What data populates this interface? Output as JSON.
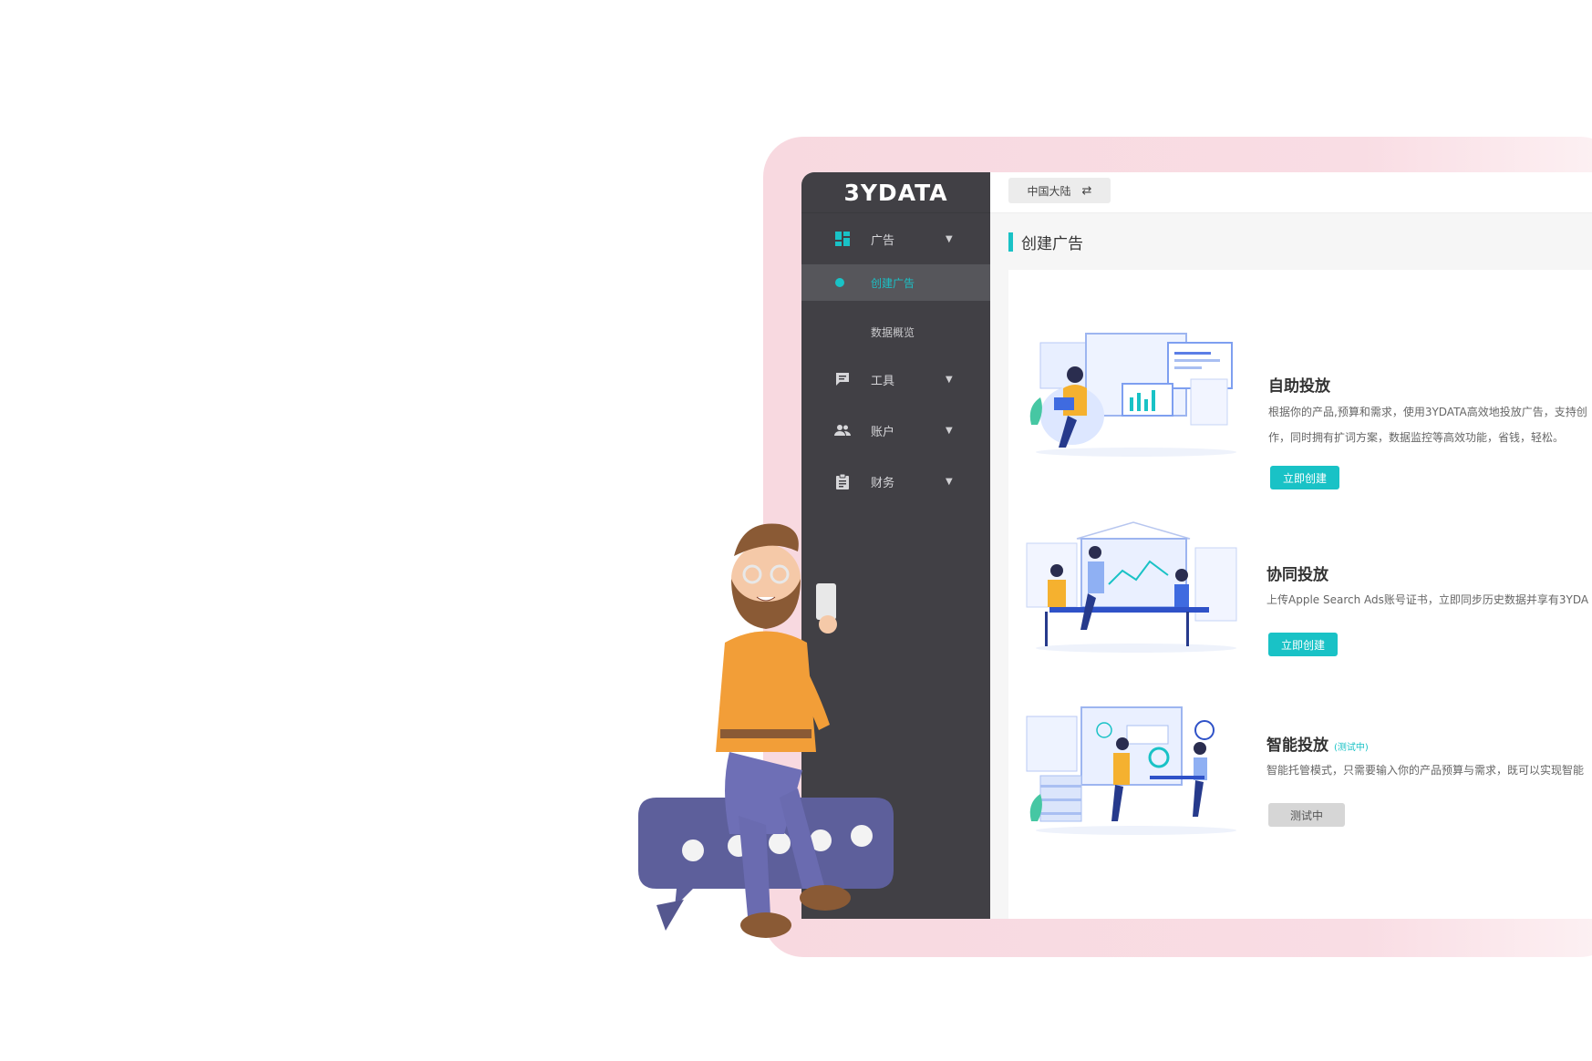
{
  "brand": {
    "logo_text": "3YDATA"
  },
  "topbar": {
    "region_label": "中国大陆",
    "region_swap_icon": "swap-icon"
  },
  "sidebar": {
    "items": [
      {
        "label": "广告",
        "icon": "dashboard-icon",
        "expanded": true
      },
      {
        "label": "工具",
        "icon": "chat-icon"
      },
      {
        "label": "账户",
        "icon": "people-icon"
      },
      {
        "label": "财务",
        "icon": "clipboard-icon"
      }
    ],
    "sub_items": [
      {
        "label": "创建广告",
        "active": true
      },
      {
        "label": "数据概览",
        "active": false
      }
    ]
  },
  "page": {
    "title": "创建广告"
  },
  "cards": [
    {
      "title": "自助投放",
      "desc_line1": "根据你的产品,预算和需求，使用3YDATA高效地投放广告，支持创",
      "desc_line2": "作，同时拥有扩词方案，数据监控等高效功能，省钱，轻松。",
      "button": "立即创建"
    },
    {
      "title": "协同投放",
      "desc_line1": "上传Apple Search  Ads账号证书，立即同步历史数据并享有3YDA",
      "button": "立即创建"
    },
    {
      "title": "智能投放",
      "badge": "(测试中)",
      "desc_line1": "智能托管模式，只需要输入你的产品预算与需求，既可以实现智能",
      "button": "测试中"
    }
  ],
  "colors": {
    "accent": "#19c2c6",
    "sidebar_bg": "#414045",
    "frame_pink": "#f8d9e0"
  }
}
